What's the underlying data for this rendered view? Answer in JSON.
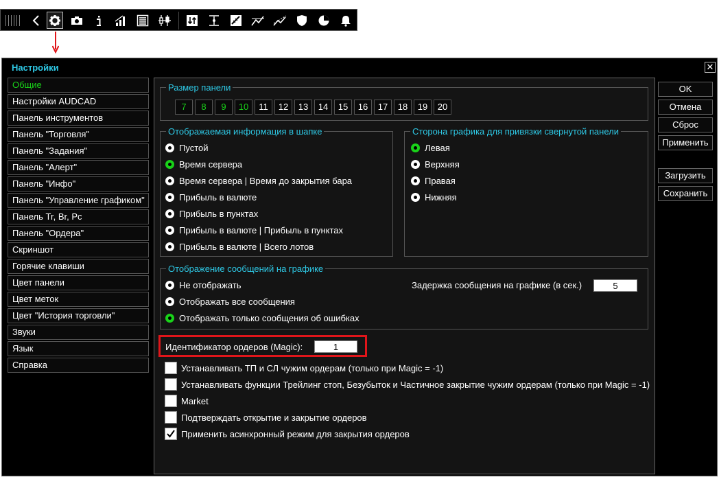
{
  "toolbar": {
    "icons": [
      "grip-icon",
      "back-icon",
      "gear-icon",
      "camera-icon",
      "info-icon",
      "signal-icon",
      "list-icon",
      "candlestick-icon",
      "transfer-icon",
      "levels-icon",
      "ruler-icon",
      "trend-icon",
      "trailing-icon",
      "shield-icon",
      "pie-icon",
      "bell-icon"
    ]
  },
  "dialog": {
    "title": "Настройки",
    "close_glyph": "✕"
  },
  "sidebar": {
    "items": [
      {
        "label": "Общие"
      },
      {
        "label": "Настройки AUDCAD"
      },
      {
        "label": "Панель инструментов"
      },
      {
        "label": "Панель \"Торговля\""
      },
      {
        "label": "Панель \"Задания\""
      },
      {
        "label": "Панель \"Алерт\""
      },
      {
        "label": "Панель \"Инфо\""
      },
      {
        "label": "Панель \"Управление графиком\""
      },
      {
        "label": "Панель Tr, Br, Pc"
      },
      {
        "label": "Панель \"Ордера\""
      },
      {
        "label": "Скриншот"
      },
      {
        "label": "Горячие клавиши"
      },
      {
        "label": "Цвет панели"
      },
      {
        "label": "Цвет меток"
      },
      {
        "label": "Цвет \"История торговли\""
      },
      {
        "label": "Звуки"
      },
      {
        "label": "Язык"
      },
      {
        "label": "Справка"
      }
    ]
  },
  "panel_size": {
    "legend": "Размер панели",
    "sizes": [
      "7",
      "8",
      "9",
      "10",
      "11",
      "12",
      "13",
      "14",
      "15",
      "16",
      "17",
      "18",
      "19",
      "20"
    ]
  },
  "header_info": {
    "legend": "Отображаемая информация в шапке",
    "options": [
      {
        "label": "Пустой"
      },
      {
        "label": "Время сервера"
      },
      {
        "label": "Время сервера | Время до закрытия бара"
      },
      {
        "label": "Прибыль в валюте"
      },
      {
        "label": "Прибыль в пунктах"
      },
      {
        "label": "Прибыль в валюте | Прибыль в пунктах"
      },
      {
        "label": "Прибыль в валюте | Всего лотов"
      }
    ]
  },
  "chart_side": {
    "legend": "Сторона графика для привязки свернутой панели",
    "options": [
      {
        "label": "Левая"
      },
      {
        "label": "Верхняя"
      },
      {
        "label": "Правая"
      },
      {
        "label": "Нижняя"
      }
    ]
  },
  "messages": {
    "legend": "Отображение сообщений на графике",
    "options": [
      {
        "label": "Не отображать"
      },
      {
        "label": "Отображать все сообщения"
      },
      {
        "label": "Отображать только сообщения об ошибках"
      }
    ],
    "delay_label": "Задержка сообщения на графике (в сек.)",
    "delay_value": "5"
  },
  "magic": {
    "label": "Идентификатор ордеров (Magic):",
    "value": "1"
  },
  "checkboxes": [
    {
      "label": "Устанавливать ТП и СЛ чужим ордерам (только при Magic = -1)"
    },
    {
      "label": "Устанавливать функции Трейлинг стоп, Безубыток и Частичное закрытие чужим ордерам (только при Magic = -1)"
    },
    {
      "label": "Market"
    },
    {
      "label": "Подтверждать открытие и закрытие ордеров"
    },
    {
      "label": "Применить асинхронный режим для закрытия ордеров"
    }
  ],
  "buttons": {
    "ok": "OK",
    "cancel": "Отмена",
    "reset": "Сброс",
    "apply": "Применить",
    "load": "Загрузить",
    "save": "Сохранить"
  },
  "colors": {
    "accent": "#2ec9e6",
    "active_green": "#19d219",
    "highlight_red": "#e0151a"
  }
}
